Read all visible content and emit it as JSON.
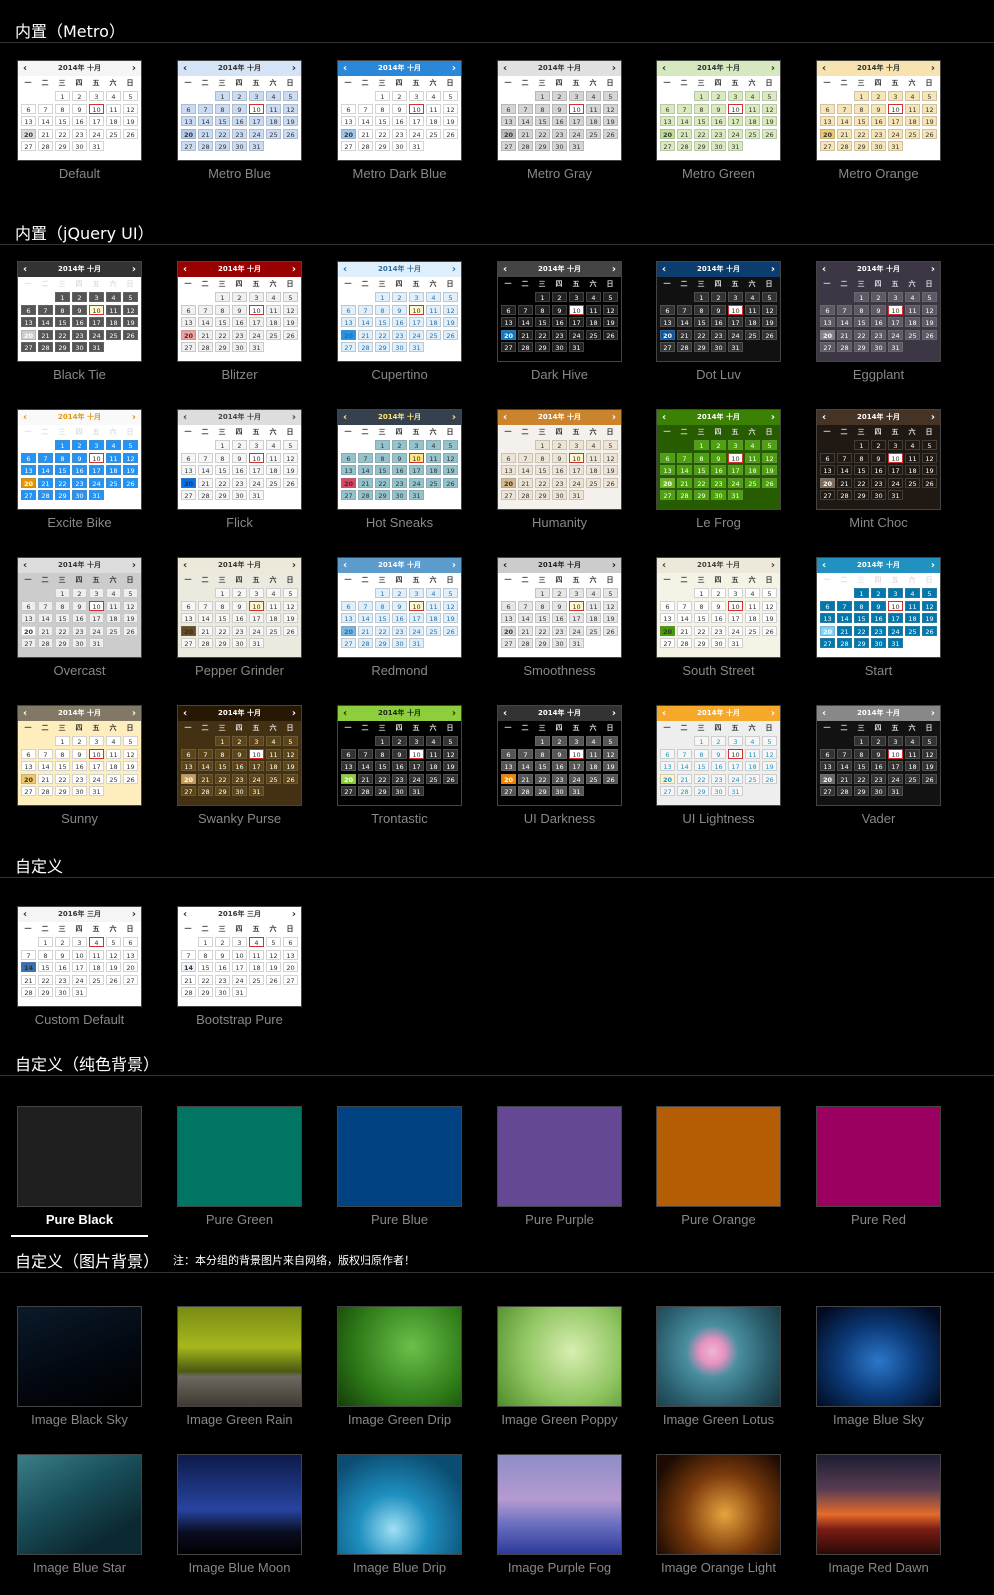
{
  "sections": [
    {
      "title": "内置（Metro）",
      "note": ""
    },
    {
      "title": "内置（jQuery UI）",
      "note": ""
    },
    {
      "title": "自定义",
      "note": ""
    },
    {
      "title": "自定义（纯色背景）",
      "note": ""
    },
    {
      "title": "自定义（图片背景）",
      "note": "注：本分组的背景图片来自网络，版权归原作者！"
    }
  ],
  "calendar_text": {
    "title_2014": "2014年 十月",
    "title_2016": "2016年 三月",
    "weekdays": [
      "一",
      "二",
      "三",
      "四",
      "五",
      "六",
      "日"
    ],
    "prev_icon": "‹",
    "next_icon": "›"
  },
  "metro": [
    {
      "label": "Default",
      "colors": {
        "hdr": "#f5f5f5",
        "hdrText": "#333",
        "bg": "#fff",
        "cell": "#fff",
        "cellText": "#333",
        "other": "#fff",
        "otherText": "#999",
        "today": "#ddd",
        "cur": "#fff"
      }
    },
    {
      "label": "Metro Blue",
      "colors": {
        "hdr": "#d4e3f5",
        "hdrText": "#333",
        "bg": "#fff",
        "cell": "#c9dcf3",
        "cellText": "#333",
        "other": "#fff",
        "otherText": "#999",
        "today": "#b0cbee",
        "cur": "#fff"
      }
    },
    {
      "label": "Metro Dark Blue",
      "colors": {
        "hdr": "#2b88d8",
        "hdrText": "#fff",
        "bg": "#fff",
        "cell": "#fff",
        "cellText": "#333",
        "other": "#fff",
        "otherText": "#999",
        "today": "#9ec8f0",
        "cur": "#fff"
      }
    },
    {
      "label": "Metro Gray",
      "colors": {
        "hdr": "#e0e0e0",
        "hdrText": "#333",
        "bg": "#fff",
        "cell": "#d5d5d5",
        "cellText": "#333",
        "other": "#fff",
        "otherText": "#999",
        "today": "#bbb",
        "cur": "#fff"
      }
    },
    {
      "label": "Metro Green",
      "colors": {
        "hdr": "#d6e8c0",
        "hdrText": "#333",
        "bg": "#fff",
        "cell": "#d9ebbc",
        "cellText": "#333",
        "other": "#fff",
        "otherText": "#999",
        "today": "#bfe094",
        "cur": "#fff"
      }
    },
    {
      "label": "Metro Orange",
      "colors": {
        "hdr": "#f6e3b0",
        "hdrText": "#333",
        "bg": "#fff",
        "cell": "#f7e5b5",
        "cellText": "#333",
        "other": "#fff",
        "otherText": "#999",
        "today": "#f0c870",
        "cur": "#fff"
      }
    }
  ],
  "jquery": [
    {
      "label": "Black Tie",
      "colors": {
        "hdr": "#333",
        "hdrText": "#fff",
        "bg": "#fff",
        "cell": "#555",
        "cellText": "#fff",
        "other": "#fff",
        "otherText": "#999",
        "today": "#ccc",
        "cur": "#fff8c8"
      }
    },
    {
      "label": "Blitzer",
      "colors": {
        "hdr": "#990000",
        "hdrText": "#fff",
        "bg": "#fff",
        "cell": "#f0f0f0",
        "cellText": "#333",
        "other": "#fff",
        "otherText": "#999",
        "today": "#f4a0a0",
        "cur": "#fff"
      }
    },
    {
      "label": "Cupertino",
      "colors": {
        "hdr": "#dfeffc",
        "hdrText": "#2e6e9e",
        "bg": "#fff",
        "cell": "#dfeffc",
        "cellText": "#2e6e9e",
        "other": "#fff",
        "otherText": "#999",
        "today": "#2694e8",
        "cur": "#fff8c8"
      }
    },
    {
      "label": "Dark Hive",
      "colors": {
        "hdr": "#444",
        "hdrText": "#fff",
        "bg": "#000",
        "cell": "#222",
        "cellText": "#fff",
        "other": "#000",
        "otherText": "#aaa",
        "today": "#0b7ac2",
        "cur": "#fff"
      }
    },
    {
      "label": "Dot Luv",
      "colors": {
        "hdr": "#0b3e6f",
        "hdrText": "#fff",
        "bg": "#111",
        "cell": "#333",
        "cellText": "#fff",
        "other": "#111",
        "otherText": "#aaa",
        "today": "#0b58a2",
        "cur": "#fff"
      }
    },
    {
      "label": "Eggplant",
      "colors": {
        "hdr": "#3d3644",
        "hdrText": "#fff",
        "bg": "#3d3644",
        "cell": "#5f5964",
        "cellText": "#fff",
        "other": "#3d3644",
        "otherText": "#ccc",
        "today": "#877f8b",
        "cur": "#fff"
      }
    },
    {
      "label": "Excite Bike",
      "colors": {
        "hdr": "#f9f9f9",
        "hdrText": "#e69700",
        "bg": "#fff",
        "cell": "#2293f7",
        "cellText": "#fff",
        "other": "#fff",
        "otherText": "#999",
        "today": "#e69700",
        "cur": "#fff"
      }
    },
    {
      "label": "Flick",
      "colors": {
        "hdr": "#ddd",
        "hdrText": "#444",
        "bg": "#fff",
        "cell": "#f6f6f6",
        "cellText": "#333",
        "other": "#fff",
        "otherText": "#999",
        "today": "#0073ea",
        "cur": "#fff"
      }
    },
    {
      "label": "Hot Sneaks",
      "colors": {
        "hdr": "#35414f",
        "hdrText": "#ffe57a",
        "bg": "#fff",
        "cell": "#93c3cd",
        "cellText": "#333",
        "other": "#fff",
        "otherText": "#999",
        "today": "#db4865",
        "cur": "#ffe57a"
      }
    },
    {
      "label": "Humanity",
      "colors": {
        "hdr": "#cb842e",
        "hdrText": "#fff",
        "bg": "#f4f0ec",
        "cell": "#ede4d4",
        "cellText": "#333",
        "other": "#f4f0ec",
        "otherText": "#999",
        "today": "#d7b98b",
        "cur": "#fff8c8"
      }
    },
    {
      "label": "Le Frog",
      "colors": {
        "hdr": "#3a8104",
        "hdrText": "#fff",
        "bg": "#285c00",
        "cell": "#4ca20b",
        "cellText": "#fff",
        "other": "#285c00",
        "otherText": "#ccc",
        "today": "#69b81b",
        "cur": "#fff"
      }
    },
    {
      "label": "Mint Choc",
      "colors": {
        "hdr": "#453326",
        "hdrText": "#fff",
        "bg": "#201913",
        "cell": "#201913",
        "cellText": "#fff",
        "other": "#201913",
        "otherText": "#bbb",
        "today": "#7a6a57",
        "cur": "#fff"
      }
    },
    {
      "label": "Overcast",
      "colors": {
        "hdr": "#ddd",
        "hdrText": "#333",
        "bg": "#ccc",
        "cell": "#eee",
        "cellText": "#333",
        "other": "#ccc",
        "otherText": "#666",
        "today": "#fff",
        "cur": "#fff"
      }
    },
    {
      "label": "Pepper Grinder",
      "colors": {
        "hdr": "#ece8da",
        "hdrText": "#333",
        "bg": "#eceadf",
        "cell": "#f8f7f6",
        "cellText": "#333",
        "other": "#eceadf",
        "otherText": "#999",
        "today": "#654b24",
        "cur": "#fff8c8"
      }
    },
    {
      "label": "Redmond",
      "colors": {
        "hdr": "#5c9ccc",
        "hdrText": "#fff",
        "bg": "#fff",
        "cell": "#dfeffc",
        "cellText": "#2e6e9e",
        "other": "#fff",
        "otherText": "#999",
        "today": "#79b7e7",
        "cur": "#fff8c8"
      }
    },
    {
      "label": "Smoothness",
      "colors": {
        "hdr": "#ccc",
        "hdrText": "#222",
        "bg": "#fff",
        "cell": "#e6e6e6",
        "cellText": "#333",
        "other": "#fff",
        "otherText": "#999",
        "today": "#dadada",
        "cur": "#fff8c8"
      }
    },
    {
      "label": "South Street",
      "colors": {
        "hdr": "#ece8da",
        "hdrText": "#433f38",
        "bg": "#f5f3e5",
        "cell": "#fefefe",
        "cellText": "#333",
        "other": "#f5f3e5",
        "otherText": "#999",
        "today": "#459e00",
        "cur": "#fff"
      }
    },
    {
      "label": "Start",
      "colors": {
        "hdr": "#2191c0",
        "hdrText": "#fff",
        "bg": "#fff",
        "cell": "#0078ae",
        "cellText": "#fff",
        "other": "#fff",
        "otherText": "#999",
        "today": "#77d5f7",
        "cur": "#fff"
      }
    },
    {
      "label": "Sunny",
      "colors": {
        "hdr": "#817865",
        "hdrText": "#fff",
        "bg": "#feeebd",
        "cell": "#ffffff",
        "cellText": "#333",
        "other": "#feeebd",
        "otherText": "#999",
        "today": "#f0c870",
        "cur": "#fff"
      }
    },
    {
      "label": "Swanky Purse",
      "colors": {
        "hdr": "#261803",
        "hdrText": "#fff",
        "bg": "#443113",
        "cell": "#5e4518",
        "cellText": "#fff",
        "other": "#443113",
        "otherText": "#ccc",
        "today": "#c59e5c",
        "cur": "#fff"
      }
    },
    {
      "label": "Trontastic",
      "colors": {
        "hdr": "#8cce3b",
        "hdrText": "#222",
        "bg": "#000",
        "cell": "#333",
        "cellText": "#fff",
        "other": "#000",
        "otherText": "#aaa",
        "today": "#8cce3b",
        "cur": "#fff"
      }
    },
    {
      "label": "UI Darkness",
      "colors": {
        "hdr": "#333",
        "hdrText": "#fff",
        "bg": "#000",
        "cell": "#555",
        "cellText": "#fff",
        "other": "#000",
        "otherText": "#aaa",
        "today": "#f58400",
        "cur": "#fff"
      }
    },
    {
      "label": "UI Lightness",
      "colors": {
        "hdr": "#f6a828",
        "hdrText": "#fff",
        "bg": "#eee",
        "cell": "#f6f6f6",
        "cellText": "#1c94c4",
        "other": "#eee",
        "otherText": "#999",
        "today": "#fdf5ce",
        "cur": "#fff"
      }
    },
    {
      "label": "Vader",
      "colors": {
        "hdr": "#888",
        "hdrText": "#fff",
        "bg": "#121212",
        "cell": "#333",
        "cellText": "#fff",
        "other": "#121212",
        "otherText": "#aaa",
        "today": "#666",
        "cur": "#fff"
      }
    }
  ],
  "custom": [
    {
      "label": "Custom Default",
      "colors": {
        "hdr": "#f5f5f5",
        "hdrText": "#333",
        "bg": "#fff",
        "cell": "#fff",
        "cellText": "#333",
        "other": "#fff",
        "otherText": "#999",
        "today": "#3571b5",
        "cur": "#fff"
      }
    },
    {
      "label": "Bootstrap Pure",
      "colors": {
        "hdr": "#fff",
        "hdrText": "#333",
        "bg": "#fff",
        "cell": "#fff",
        "cellText": "#333",
        "other": "#fff",
        "otherText": "#999",
        "today": "#eef4fb",
        "cur": "#fff"
      }
    }
  ],
  "pure": [
    {
      "label": "Pure Black",
      "color": "#1f1f1f",
      "selected": true
    },
    {
      "label": "Pure Green",
      "color": "#007563",
      "selected": false
    },
    {
      "label": "Pure Blue",
      "color": "#014282",
      "selected": false
    },
    {
      "label": "Pure Purple",
      "color": "#644893",
      "selected": false
    },
    {
      "label": "Pure Orange",
      "color": "#b55d04",
      "selected": false
    },
    {
      "label": "Pure Red",
      "color": "#9b0060",
      "selected": false
    }
  ],
  "images": [
    {
      "label": "Image Black Sky",
      "bg": "linear-gradient(160deg,#0b1a2a,#02070f 60%,#000)"
    },
    {
      "label": "Image Green Rain",
      "bg": "linear-gradient(180deg,#7a8a14 0%,#a6b81d 40%,#4a5a10 65%,#6d6a60 70%,#3f3a33 100%)"
    },
    {
      "label": "Image Green Drip",
      "bg": "radial-gradient(circle at 60% 40%,#6cc04a,#2e7a18 60%,#143d08)"
    },
    {
      "label": "Image Green Poppy",
      "bg": "radial-gradient(circle at 60% 45%,#d7efb0,#8fc460 55%,#4f8b2b)"
    },
    {
      "label": "Image Green Lotus",
      "bg": "radial-gradient(circle at 45% 45%,#ecb6d4 0,#e892c0 14%,#4a8fa0 30%,#2a5d6c 65%,#16333c)"
    },
    {
      "label": "Image Blue Sky",
      "bg": "radial-gradient(ellipse at 50% 55%,#2b78c9,#0c3b7a 45%,#020b22 90%)"
    },
    {
      "label": "Image Blue Star",
      "bg": "linear-gradient(150deg,#3d7e86,#19505c 40%,#0c2830 80%)"
    },
    {
      "label": "Image Blue Moon",
      "bg": "linear-gradient(180deg,#0d1a4a,#2744a0 55%,#0a0d22 78%,#000)"
    },
    {
      "label": "Image Blue Drip",
      "bg": "radial-gradient(circle at 45% 75%,#9fe0f5,#1f8fbf 35%,#0b4c72 80%)"
    },
    {
      "label": "Image Purple Fog",
      "bg": "linear-gradient(180deg,#8e8ec6,#b59ad0 45%,#6a6fc0 70%,#2d3a9a)"
    },
    {
      "label": "Image Orange Light",
      "bg": "radial-gradient(circle at 55% 60%,#e8a43e,#7a3a0b 45%,#1d0b03 85%)"
    },
    {
      "label": "Image Red Dawn",
      "bg": "linear-gradient(180deg,#1c1d34,#5a3d52 35%,#e56b2a 60%,#7a1c14 75%,#2a0a08)"
    }
  ]
}
